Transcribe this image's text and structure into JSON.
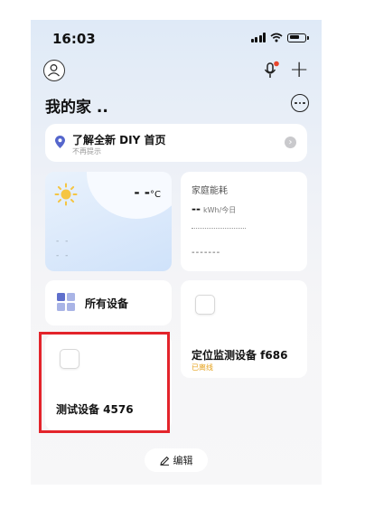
{
  "status_bar": {
    "time": "16:03"
  },
  "header": {
    "home_title": "我的家 .."
  },
  "banner": {
    "title": "了解全新 DIY 首页",
    "subtitle": "不再提示"
  },
  "weather": {
    "temperature": "- -",
    "unit": "°C",
    "line1": "- -",
    "line2": "- -"
  },
  "energy": {
    "title": "家庭能耗",
    "value": "--",
    "unit": "kWh/今日",
    "placeholder": "-------"
  },
  "all_devices": {
    "label": "所有设备"
  },
  "devices": [
    {
      "name": "定位监测设备 f686",
      "status": "已离线"
    },
    {
      "name": "测试设备 4576"
    }
  ],
  "edit": {
    "label": "编辑"
  },
  "colors": {
    "highlight": "#e3242b",
    "offline": "#e5a21c",
    "mic_dot": "#e8452c"
  }
}
